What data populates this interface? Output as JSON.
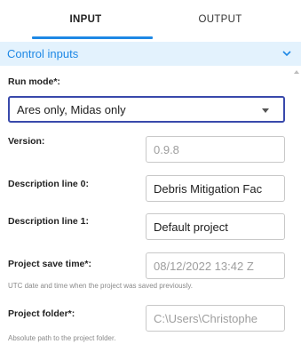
{
  "tabs": {
    "input": "INPUT",
    "output": "OUTPUT",
    "active": "INPUT"
  },
  "section": {
    "title": "Control inputs",
    "icon": "chevron-down-icon",
    "accent_color": "#1e88e5",
    "header_bg": "#e3f2fd"
  },
  "fields": {
    "run_mode": {
      "label": "Run mode*:",
      "value": "Ares only, Midas only"
    },
    "version": {
      "label": "Version:",
      "value": "0.9.8"
    },
    "description_0": {
      "label": "Description line 0:",
      "value": "Debris Mitigation Fac"
    },
    "description_1": {
      "label": "Description line 1:",
      "value": "Default project"
    },
    "project_save_time": {
      "label": "Project save time*:",
      "value": "08/12/2022 13:42 Z",
      "help": "UTC date and time when the project was saved previously."
    },
    "project_folder": {
      "label": "Project folder*:",
      "value": "C:\\Users\\Christophe",
      "help": "Absolute path to the project folder."
    }
  }
}
